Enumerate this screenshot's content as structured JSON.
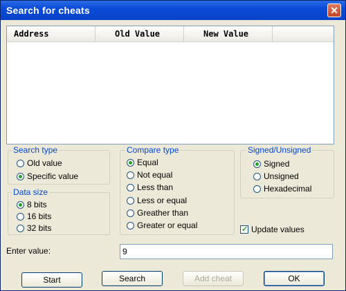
{
  "window": {
    "title": "Search for cheats",
    "close_glyph": "✕"
  },
  "results": {
    "columns": [
      "Address",
      "Old Value",
      "New Value",
      ""
    ],
    "rows": []
  },
  "search_type": {
    "title": "Search type",
    "options": [
      {
        "label": "Old value",
        "selected": false
      },
      {
        "label": "Specific value",
        "selected": true
      }
    ]
  },
  "data_size": {
    "title": "Data size",
    "options": [
      {
        "label": "8 bits",
        "selected": true
      },
      {
        "label": "16 bits",
        "selected": false
      },
      {
        "label": "32 bits",
        "selected": false
      }
    ]
  },
  "compare_type": {
    "title": "Compare type",
    "options": [
      {
        "label": "Equal",
        "selected": true
      },
      {
        "label": "Not equal",
        "selected": false
      },
      {
        "label": "Less than",
        "selected": false
      },
      {
        "label": "Less or equal",
        "selected": false
      },
      {
        "label": "Greather than",
        "selected": false
      },
      {
        "label": "Greater or equal",
        "selected": false
      }
    ]
  },
  "signed_unsigned": {
    "title": "Signed/Unsigned",
    "options": [
      {
        "label": "Signed",
        "selected": true
      },
      {
        "label": "Unsigned",
        "selected": false
      },
      {
        "label": "Hexadecimal",
        "selected": false
      }
    ]
  },
  "update_values": {
    "label": "Update values",
    "checked": true
  },
  "enter_value": {
    "label": "Enter value:",
    "value": "9"
  },
  "buttons": {
    "start": "Start",
    "search": "Search",
    "add_cheat": "Add cheat",
    "ok": "OK"
  }
}
